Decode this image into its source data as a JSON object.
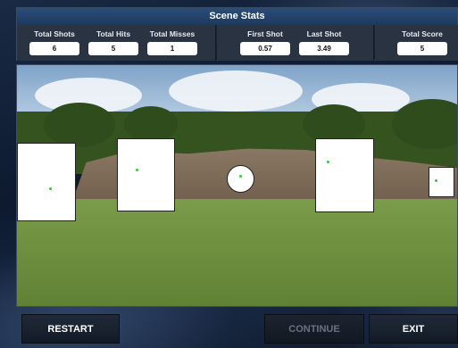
{
  "panel": {
    "title": "Scene Stats"
  },
  "stats": {
    "total_shots": {
      "label": "Total Shots",
      "value": "6"
    },
    "total_hits": {
      "label": "Total Hits",
      "value": "5"
    },
    "total_misses": {
      "label": "Total Misses",
      "value": "1"
    },
    "first_shot": {
      "label": "First Shot",
      "value": "0.57"
    },
    "last_shot": {
      "label": "Last Shot",
      "value": "3.49"
    },
    "total_score": {
      "label": "Total Score",
      "value": "5"
    }
  },
  "buttons": {
    "restart": "RESTART",
    "continue": "CONTINUE",
    "exit": "EXIT"
  },
  "colors": {
    "header_bar": "#2a4d78",
    "hit_marker": "#2fcf2f",
    "disabled_text": "#6a7280"
  }
}
